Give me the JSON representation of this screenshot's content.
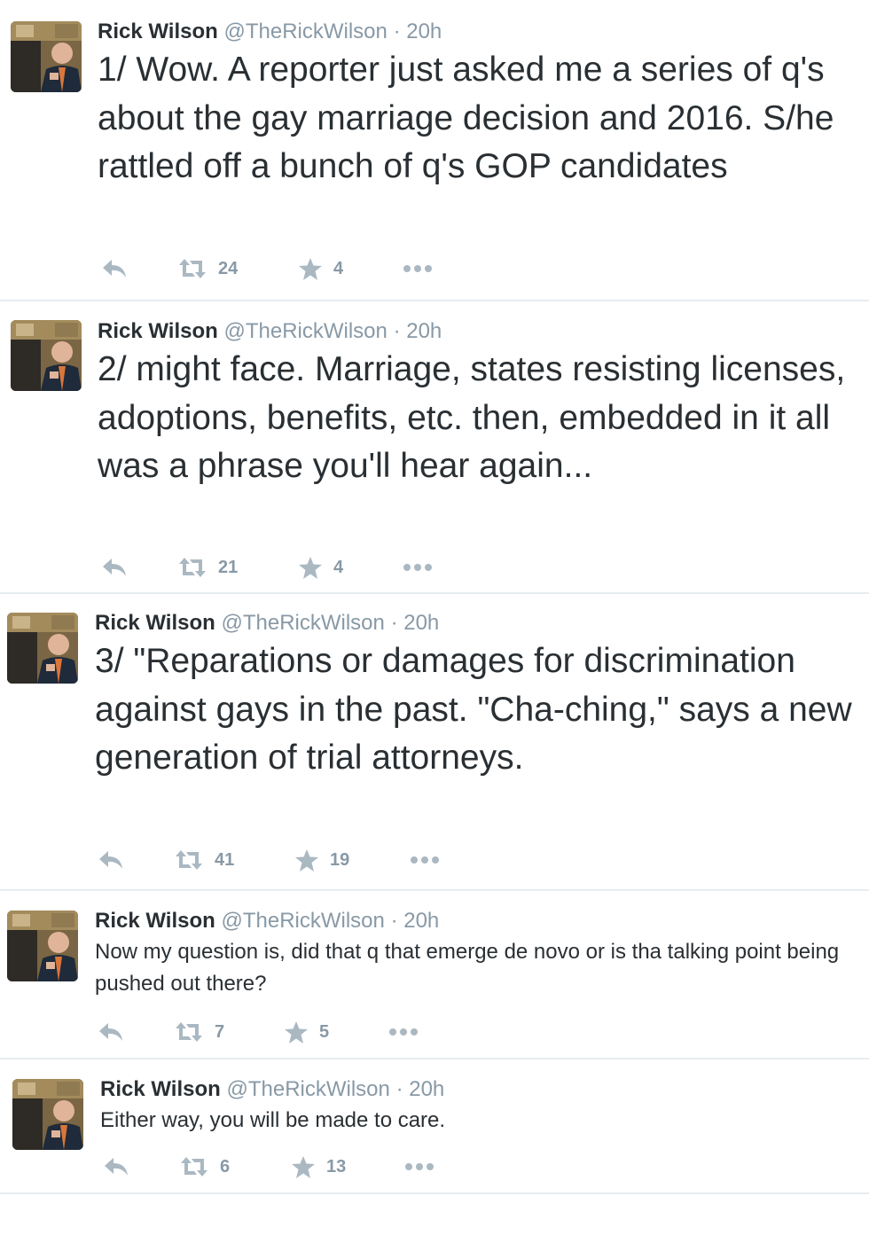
{
  "tweets": [
    {
      "name": "Rick Wilson",
      "handle": "@TheRickWilson",
      "separator": "·",
      "time": "20h",
      "text": "1/ Wow. A reporter just asked me a series of q's about the gay marriage decision and 2016. S/he rattled off a bunch of q's GOP candidates",
      "retweets": "24",
      "favorites": "4"
    },
    {
      "name": "Rick Wilson",
      "handle": "@TheRickWilson",
      "separator": "·",
      "time": "20h",
      "text": "2/ might face. Marriage, states resisting licenses, adoptions, benefits, etc. then, embedded in it all was a phrase you'll hear again...",
      "retweets": "21",
      "favorites": "4"
    },
    {
      "name": "Rick Wilson",
      "handle": "@TheRickWilson",
      "separator": "·",
      "time": "20h",
      "text": "3/ \"Reparations or damages for discrimination against gays in the past. \"Cha-ching,\" says a new generation of trial attorneys.",
      "retweets": "41",
      "favorites": "19"
    },
    {
      "name": "Rick Wilson",
      "handle": "@TheRickWilson",
      "separator": "·",
      "time": "20h",
      "text": "Now my question is, did that q that emerge de novo or is tha talking point being pushed out there?",
      "retweets": "7",
      "favorites": "5"
    },
    {
      "name": "Rick Wilson",
      "handle": "@TheRickWilson",
      "separator": "·",
      "time": "20h",
      "text": "Either way, you will be made to care.",
      "retweets": "6",
      "favorites": "13"
    }
  ],
  "icons": {
    "reply": "reply-icon",
    "retweet": "retweet-icon",
    "favorite": "star-icon",
    "more": "more-icon"
  },
  "colors": {
    "name": "#292f33",
    "meta": "#8899a6",
    "icon": "#aab8c2",
    "divider": "#e6ecf0"
  }
}
